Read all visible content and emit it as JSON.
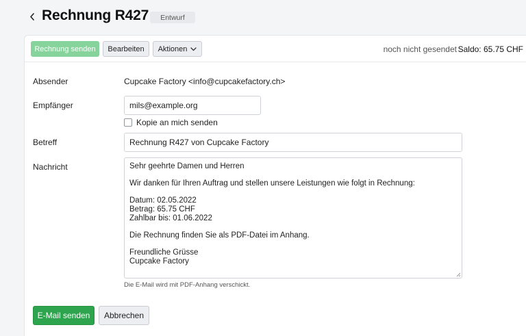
{
  "header": {
    "title": "Rechnung R427",
    "status_badge": "Entwurf"
  },
  "toolbar": {
    "send_invoice_label": "Rechnung senden",
    "edit_label": "Bearbeiten",
    "actions_label": "Aktionen",
    "send_status": "noch nicht gesendet",
    "saldo": "Saldo: 65.75 CHF"
  },
  "form": {
    "sender_label": "Absender",
    "sender_value": "Cupcake Factory <info@cupcakefactory.ch>",
    "recipient_label": "Empfänger",
    "recipient_value": "mils@example.org",
    "copy_label": "Kopie an mich senden",
    "subject_label": "Betreff",
    "subject_value": "Rechnung R427 von Cupcake Factory",
    "message_label": "Nachricht",
    "message_lines": {
      "l1": "Sehr geehrte Damen und Herren",
      "l2": "Wir danken für Ihren Auftrag und stellen unsere Leistungen wie folgt in Rechnung:",
      "l3": "Datum: 02.05.2022",
      "l4": "Betrag: 65.75 CHF",
      "l5": "Zahlbar bis: 01.06.2022",
      "l6": "Die Rechnung finden Sie als PDF-Datei im Anhang.",
      "l7": "Freundliche Grüsse",
      "l8": "Cupcake Factory"
    },
    "hint": "Die E-Mail wird mit PDF-Anhang verschickt."
  },
  "footer": {
    "send_email_label": "E-Mail senden",
    "cancel_label": "Abbrechen"
  },
  "colors": {
    "primary_green": "#2ea44f",
    "disabled_green": "#86d39c",
    "badge_bg": "#e8e9ec"
  },
  "icons": {
    "back": "chevron-left-icon",
    "actions_dropdown": "chevron-down-icon"
  }
}
